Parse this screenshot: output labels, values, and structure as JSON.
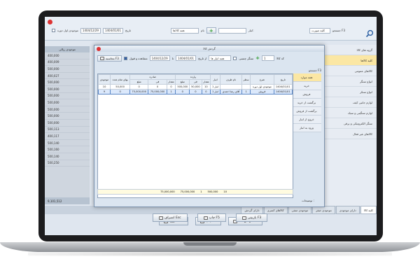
{
  "top": {
    "search_label": "جستجو F3",
    "group_label": "کلیه صورت",
    "field_label_1": "انبار:",
    "field_label_2": "نام",
    "field_value_2": "همه کالاها",
    "date_from": "1404/01/01",
    "date_to": "1404/12/29",
    "date_label": "تاریخ",
    "checkbox_label": "موجودی اول دوره"
  },
  "sidebar": {
    "items": [
      "گروه های کالا",
      "کلیه کالاها",
      "کالاهای عمومی",
      "انواع سنگر",
      "انواع سنکر",
      "لوازم جانبی کیف",
      "لوازم سنگینی و سبک",
      "سنگر الکترونیکی و برقی",
      "کالاهای غیر فعال"
    ]
  },
  "leftcol": {
    "header": "موجودی ریالی",
    "values": [
      "400,000",
      "400,009",
      "500,000",
      "400,027",
      "500,000",
      "500,000",
      "500,000",
      "500,000",
      "500,000",
      "500,000",
      "500,000",
      "500,113",
      "400,117",
      "500,140",
      "500,160",
      "500,140",
      "500,250"
    ],
    "total": "9,101,512"
  },
  "tabs": [
    "کلیه کالا",
    "داراى موجودى",
    "موجودى صفر",
    "موجودى منفى",
    "کالاهای کسری",
    "داراى گردش"
  ],
  "bottom_buttons": {
    "print": "چاپ F5",
    "exit": "خروج Esc",
    "turnover": "گردش کالا F5"
  },
  "dialog": {
    "title": "گردش کالا",
    "close_label": "x",
    "row1": {
      "code_label": "کد کالا",
      "code_value": "1",
      "all_label": "سنگر چسبی",
      "warehouse_label": "همه انبار ها",
      "from_label": "از تاریخ",
      "from_value": "1404/01/01",
      "to_label": "تا",
      "to_value": "1404/12/29",
      "show_details_label": "مشاهده و قبول",
      "recalc_button": "محاسبه F3"
    },
    "search_label": "جستجو F3",
    "menu_items": [
      "همه موارد",
      "خرید",
      "فروش",
      "برگشت از خرید",
      "برگشت از فروش",
      "خروج از انبار",
      "ورود به انبار"
    ],
    "table": {
      "group_headers": [
        "وارده",
        "صادره"
      ],
      "columns": [
        "تاریخ",
        "شرح",
        "سطر",
        "نام طرف",
        "انبار",
        "مقدار",
        "فی",
        "مبلغ",
        "مقدار",
        "فی",
        "مبلغ",
        "بهای تمام شده",
        "موجودی"
      ],
      "rows": [
        [
          "1404/01/01",
          "موجودی اول دوره",
          "",
          "",
          "انبار 1",
          "10",
          "50,000",
          "500,000",
          "0",
          "0",
          "0",
          "50,000",
          "10"
        ],
        [
          "1404/01/01",
          "فروش",
          "1",
          "آقای رضا احمدی",
          "انبار 1",
          "0",
          "0",
          "0",
          "1",
          "75,000,000",
          "75,000,000",
          "0",
          "9"
        ]
      ]
    },
    "totals": {
      "in_qty": "10",
      "in_amount": "500,000",
      "out_qty": "1",
      "out_amount": "75,000,000",
      "cost": "75,000,000"
    },
    "notes_label": "توضیحات :",
    "buttons": {
      "exit": "انصراف Esc",
      "print": "چاپ F5",
      "view": "بازبینی F3"
    }
  }
}
